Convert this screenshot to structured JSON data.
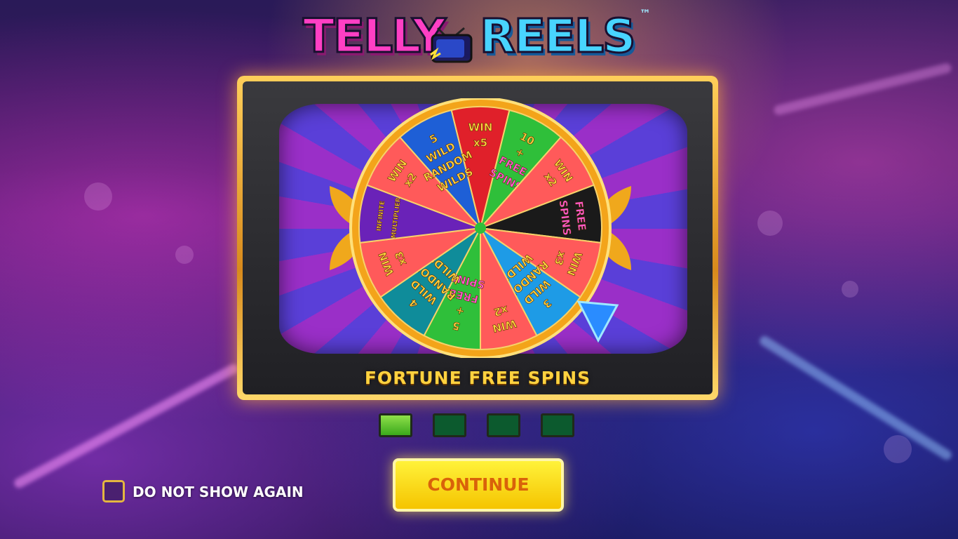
{
  "logo": {
    "word1": "TELLY",
    "word2": "REELS",
    "trademark": "™"
  },
  "caption": "FORTUNE FREE SPINS",
  "wheel": {
    "segments": [
      {
        "lines": [
          "WIN",
          "x5"
        ],
        "color": "#e0202a"
      },
      {
        "lines": [
          "10",
          "+",
          "FREE",
          "SPINS"
        ],
        "color": "#2fbf3a"
      },
      {
        "lines": [
          "WIN",
          "x2"
        ],
        "color": "#ff5a5a"
      },
      {
        "lines": [
          "FREE",
          "SPINS"
        ],
        "color": "#1a1a1a"
      },
      {
        "lines": [
          "WIN",
          "x3"
        ],
        "color": "#ff5a5a"
      },
      {
        "lines": [
          "3",
          "WILD",
          "RANDOM",
          "WILDS"
        ],
        "color": "#1e9be6"
      },
      {
        "lines": [
          "WIN",
          "x2"
        ],
        "color": "#ff5a5a"
      },
      {
        "lines": [
          "5",
          "+",
          "FREE",
          "SPINS"
        ],
        "color": "#2fbf3a"
      },
      {
        "lines": [
          "4",
          "WILD",
          "RANDOM",
          "WILDS"
        ],
        "color": "#0f8c9a"
      },
      {
        "lines": [
          "WIN",
          "x3"
        ],
        "color": "#ff5a5a"
      },
      {
        "lines": [
          "INFINITE",
          "MULTIPLIER"
        ],
        "color": "#6a22b8"
      },
      {
        "lines": [
          "WIN",
          "x2"
        ],
        "color": "#ff5a5a"
      },
      {
        "lines": [
          "5",
          "WILD",
          "RANDOM",
          "WILDS"
        ],
        "color": "#1e5fd6"
      }
    ]
  },
  "pagination": {
    "total": 4,
    "active": 1
  },
  "continue_label": "CONTINUE",
  "do_not_show_label": "DO NOT SHOW AGAIN"
}
